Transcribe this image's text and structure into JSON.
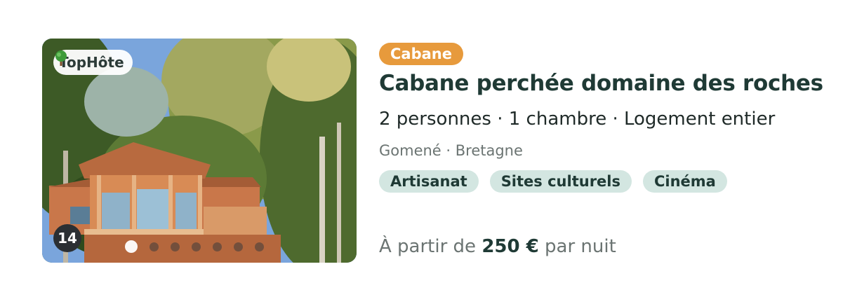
{
  "listing": {
    "host_badge": "TopHôte",
    "photo_count": "14",
    "carousel": {
      "total_dots": 7,
      "active_index": 0
    },
    "type": "Cabane",
    "title": "Cabane perchée domaine des roches",
    "specs": "2 personnes · 1 chambre · Logement entier",
    "location": "Gomené · Bretagne",
    "tags": [
      "Artisanat",
      "Sites culturels",
      "Cinéma"
    ],
    "price": {
      "prefix": "À partir de",
      "amount": "250 €",
      "suffix": "par nuit"
    }
  },
  "colors": {
    "type_badge": "#e79a3c",
    "tag_bg": "#d3e6e1",
    "title": "#1f3a35",
    "muted": "#6b7472"
  },
  "icons": {
    "host_badge_icon": "tree-icon"
  }
}
